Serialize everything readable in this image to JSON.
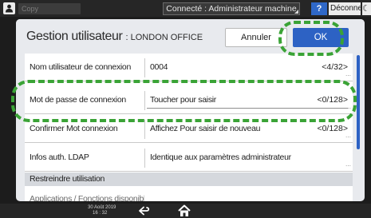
{
  "topbar": {
    "copy_label": "Copy",
    "connection_status": "Connecté : Administrateur machine",
    "help_label": "?",
    "logout_label": "Déconnexion",
    "moon_icon": "moon-icon"
  },
  "dialog": {
    "title": "Gestion utilisateur",
    "subtitle": ": LONDON OFFICE",
    "cancel_label": "Annuler",
    "ok_label": "OK"
  },
  "rows": {
    "login_user": {
      "label": "Nom utilisateur de connexion",
      "value": "0004",
      "count": "<4/32>"
    },
    "login_password": {
      "label": "Mot de passe de connexion",
      "placeholder": "Toucher pour saisir",
      "count": "<0/128>"
    },
    "confirm_password": {
      "label": "Confirmer Mot connexion",
      "value": "Affichez Pour saisir de nouveau",
      "count": "<0/128>"
    },
    "ldap": {
      "label": "Infos auth. LDAP",
      "value": "Identique aux paramètres administrateur"
    }
  },
  "sections": {
    "restrict": "Restreindre utilisation"
  },
  "partial_row": {
    "label": "Applications / Fonctions disponibles"
  },
  "bottombar": {
    "date": "30 Août 2019",
    "time": "16 : 32"
  },
  "colors": {
    "accent": "#2d62c4",
    "highlight": "#3aa336"
  }
}
